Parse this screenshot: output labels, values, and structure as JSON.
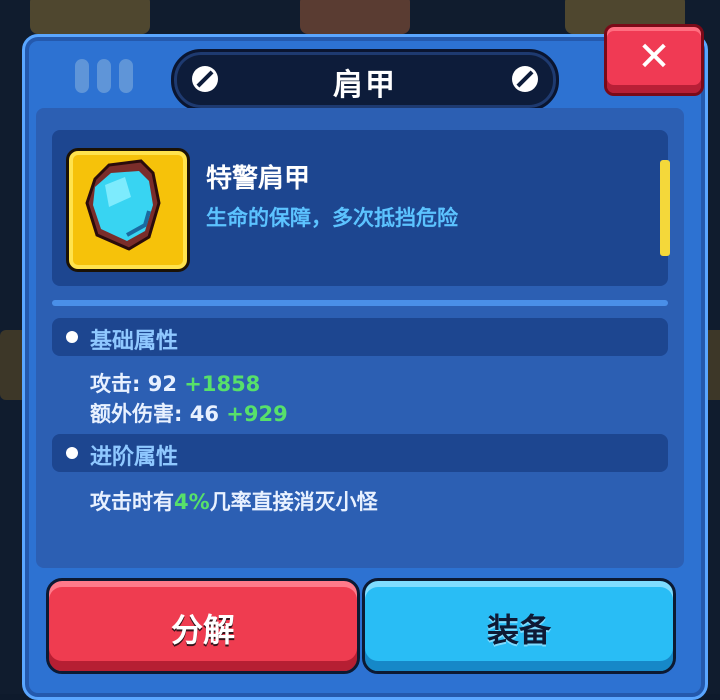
{
  "dialog": {
    "title": "肩甲",
    "close_icon": "close-x-icon"
  },
  "item": {
    "name": "特警肩甲",
    "description": "生命的保障，多次抵挡危险",
    "icon": "shoulder-armor-icon",
    "rarity_color": "#f6c20a"
  },
  "sections": {
    "basic": {
      "label": "基础属性",
      "stats": [
        {
          "label": "攻击: 92",
          "bonus": "+1858"
        },
        {
          "label": "额外伤害: 46",
          "bonus": "+929"
        }
      ]
    },
    "advanced": {
      "label": "进阶属性",
      "text_before": "攻击时有",
      "highlight": "4%",
      "text_after": "几率直接消灭小怪"
    }
  },
  "buttons": {
    "decompose_label": "分解",
    "equip_label": "装备"
  },
  "colors": {
    "panel": "#2d72d2",
    "bonus_green": "#57e06a",
    "decompose_red": "#ef3c50",
    "equip_blue": "#29bdf5"
  }
}
